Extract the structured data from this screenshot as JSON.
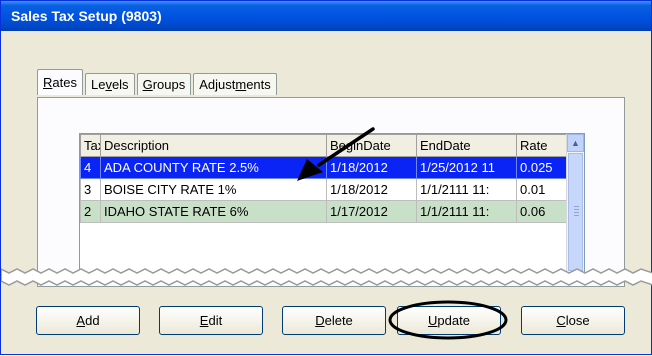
{
  "window": {
    "title": "Sales Tax Setup (9803)"
  },
  "tabs": [
    {
      "label": "Rates",
      "mnemonic": "R",
      "rest": "ates",
      "active": true
    },
    {
      "label": "Levels",
      "pre": "Le",
      "mnemonic": "v",
      "rest": "els"
    },
    {
      "label": "Groups",
      "mnemonic": "G",
      "rest": "roups"
    },
    {
      "label": "Adjustments",
      "pre": "Adjust",
      "mnemonic": "m",
      "rest": "ents"
    }
  ],
  "grid": {
    "columns": [
      "Tax",
      "Description",
      "BeginDate",
      "EndDate",
      "Rate"
    ],
    "rows": [
      {
        "tax": "4",
        "description": "ADA COUNTY RATE 2.5%",
        "begin": "1/18/2012",
        "end": "1/25/2012 11",
        "rate": "0.025",
        "state": "selected"
      },
      {
        "tax": "3",
        "description": "BOISE CITY RATE 1%",
        "begin": "1/18/2012",
        "end": "1/1/2111 11:",
        "rate": "0.01",
        "state": "normal"
      },
      {
        "tax": "2",
        "description": "IDAHO STATE RATE 6%",
        "begin": "1/17/2012",
        "end": "1/1/2111 11:",
        "rate": "0.06",
        "state": "alternate"
      }
    ]
  },
  "buttons": {
    "add": {
      "mnemonic": "A",
      "rest": "dd"
    },
    "edit": {
      "mnemonic": "E",
      "rest": "dit"
    },
    "delete": {
      "mnemonic": "D",
      "rest": "elete"
    },
    "update": {
      "mnemonic": "U",
      "rest": "pdate"
    },
    "close": {
      "mnemonic": "C",
      "rest": "lose"
    }
  },
  "colors": {
    "title_bar": "#0054e3",
    "selected_row": "#0a24f5",
    "alternate_row": "#c8e0c8",
    "callout": "#000000"
  }
}
